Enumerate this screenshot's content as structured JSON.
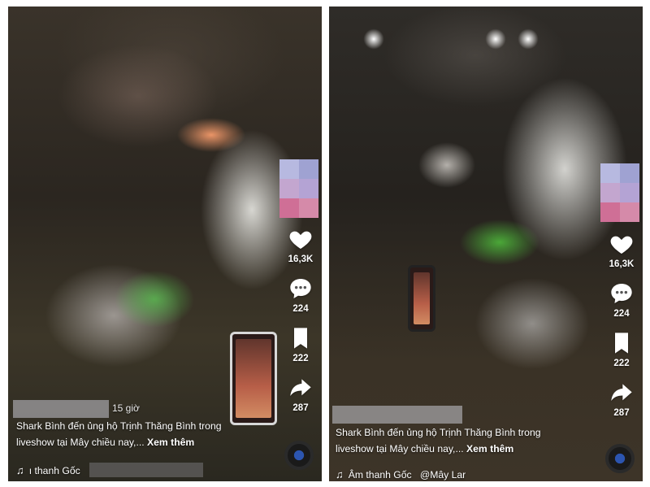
{
  "colors": {
    "icon": "#ffffff",
    "text": "#ffffff"
  },
  "left": {
    "time_ago": "15 giờ",
    "caption_text": "Shark Bình đến ủng hộ Trịnh Thăng Bình trong liveshow tại Mây chiều nay,...",
    "more_label": "Xem thêm",
    "audio_text": "ı thanh Gốc",
    "likes": "16,3K",
    "comments": "224",
    "saves": "222",
    "shares": "287"
  },
  "right": {
    "caption_text": "Shark Bình đến ủng hộ Trịnh Thăng Bình trong liveshow tại Mây chiều nay,...",
    "more_label": "Xem thêm",
    "audio_text": "Âm thanh Gốc",
    "audio_author": "@Mây Lar",
    "likes": "16,3K",
    "comments": "224",
    "saves": "222",
    "shares": "287"
  },
  "icons": {
    "like": "heart-icon",
    "comment": "comment-icon",
    "save": "bookmark-icon",
    "share": "share-icon",
    "music": "music-note-icon"
  }
}
